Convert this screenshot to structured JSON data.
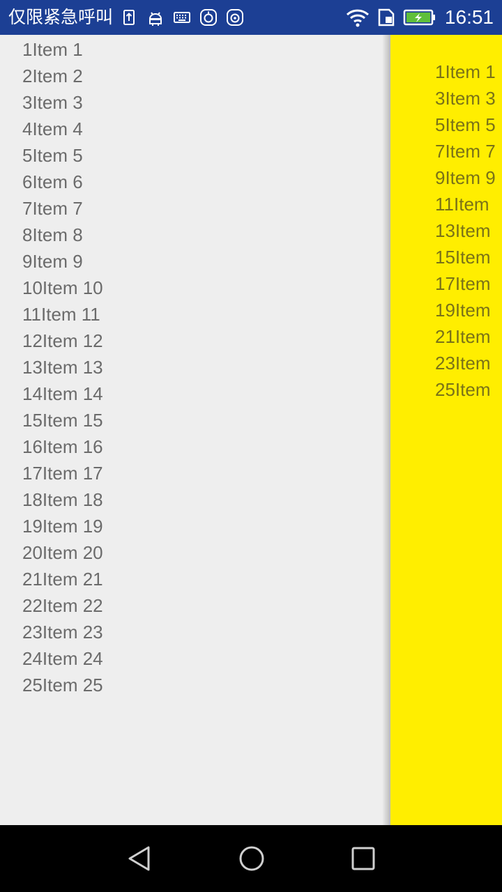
{
  "status_bar": {
    "carrier": "仅限紧急呼叫",
    "time": "16:51",
    "notification_icons": [
      "sim-upload-icon",
      "android-icon",
      "keyboard-icon",
      "app-icon",
      "app-icon"
    ],
    "system_icons": [
      "wifi-icon",
      "sim-icon",
      "battery-charging-icon"
    ],
    "background": "#1c3f94"
  },
  "main_list": {
    "items": [
      "1Item 1",
      "2Item 2",
      "3Item 3",
      "4Item 4",
      "5Item 5",
      "6Item 6",
      "7Item 7",
      "8Item 8",
      "9Item 9",
      "10Item 10",
      "11Item 11",
      "12Item 12",
      "13Item 13",
      "14Item 14",
      "15Item 15",
      "16Item 16",
      "17Item 17",
      "18Item 18",
      "19Item 19",
      "20Item 20",
      "21Item 21",
      "22Item 22",
      "23Item 23",
      "24Item 24",
      "25Item 25"
    ],
    "background": "#eeeeee"
  },
  "drawer": {
    "items": [
      "1Item 1",
      "3Item 3",
      "5Item 5",
      "7Item 7",
      "9Item 9",
      "11Item",
      "13Item",
      "15Item",
      "17Item",
      "19Item",
      "21Item",
      "23Item",
      "25Item"
    ],
    "background": "#ffee00"
  },
  "nav_bar": {
    "buttons": [
      "back-icon",
      "home-icon",
      "recents-icon"
    ]
  }
}
